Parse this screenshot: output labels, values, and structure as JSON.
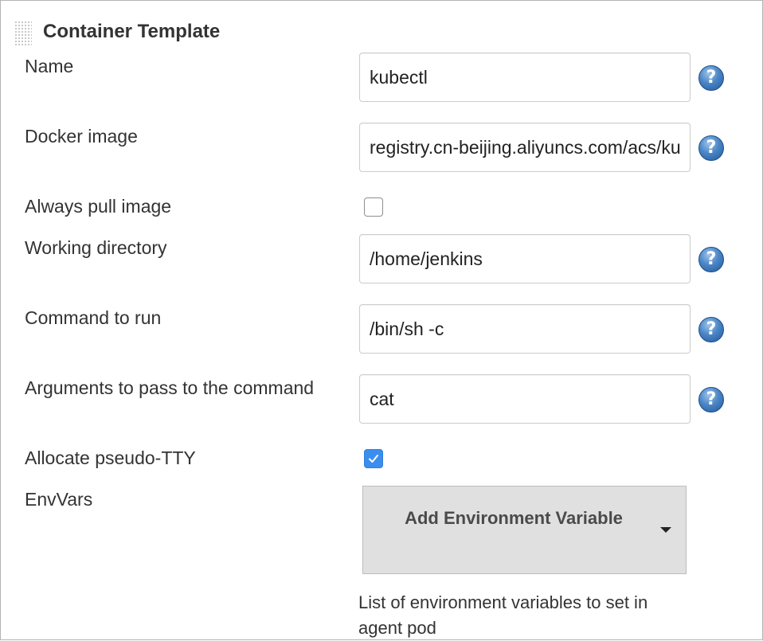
{
  "section": {
    "title": "Container Template"
  },
  "fields": {
    "name": {
      "label": "Name",
      "value": "kubectl"
    },
    "docker_image": {
      "label": "Docker image",
      "value": "registry.cn-beijing.aliyuncs.com/acs/kubectl"
    },
    "always_pull": {
      "label": "Always pull image",
      "checked": false
    },
    "working_dir": {
      "label": "Working directory",
      "value": "/home/jenkins"
    },
    "command": {
      "label": "Command to run",
      "value": "/bin/sh -c"
    },
    "arguments": {
      "label": "Arguments to pass to the command",
      "value": "cat"
    },
    "tty": {
      "label": "Allocate pseudo-TTY",
      "checked": true
    },
    "envvars": {
      "label": "EnvVars",
      "button_label": "Add Environment Variable",
      "help_text": "List of environment variables to set in agent pod"
    }
  },
  "help": {
    "glyph": "?"
  },
  "icons": {
    "help": "help-icon",
    "checkmark": "checkmark-icon",
    "dropdown": "chevron-down-icon",
    "drag_handle": "drag-handle-icon"
  },
  "colors": {
    "checkbox_checked": "#3b8ef0",
    "help_icon": "#4b86c6",
    "button_bg": "#e0e0e0"
  }
}
